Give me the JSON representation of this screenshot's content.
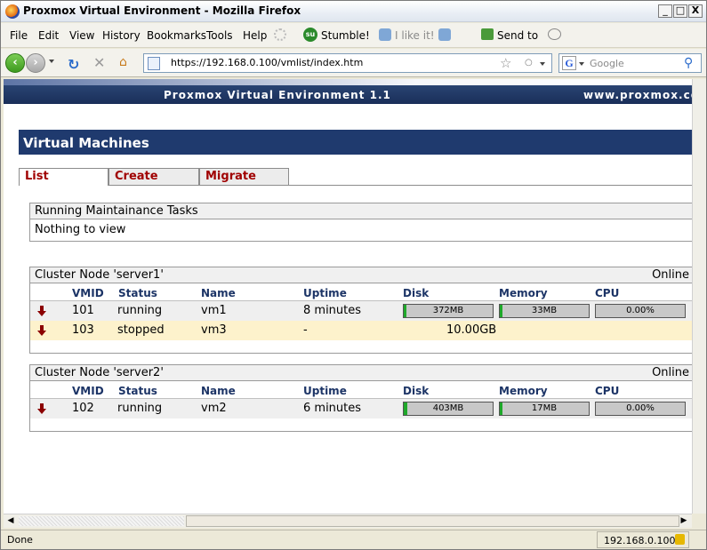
{
  "window": {
    "title": "Proxmox Virtual Environment - Mozilla Firefox",
    "minimize": "_",
    "maximize": "□",
    "close": "X"
  },
  "menu": [
    "File",
    "Edit",
    "View",
    "History",
    "Bookmarks",
    "Tools",
    "Help"
  ],
  "toolbar": {
    "stumble": "Stumble!",
    "like": "I like it!",
    "send_to": "Send to"
  },
  "nav": {
    "url": "https://192.168.0.100/vmlist/index.htm",
    "search_placeholder": "Google"
  },
  "page": {
    "banner_title": "Proxmox Virtual Environment 1.1",
    "banner_url": "www.proxmox.com",
    "section_title": "Virtual Machines",
    "tabs": [
      "List",
      "Create",
      "Migrate"
    ],
    "tasks": {
      "title": "Running Maintainance Tasks",
      "empty": "Nothing to view"
    },
    "columns": [
      "VMID",
      "Status",
      "Name",
      "Uptime",
      "Disk",
      "Memory",
      "CPU"
    ],
    "nodes": [
      {
        "title": "Cluster Node 'server1'",
        "state": "Online",
        "vms": [
          {
            "vmid": "101",
            "status": "running",
            "name": "vm1",
            "uptime": "8 minutes",
            "disk": "372MB",
            "disk_fill": 0.03,
            "memory": "33MB",
            "memory_fill": 0.03,
            "cpu": "0.00%",
            "cpu_fill": 0.0
          },
          {
            "vmid": "103",
            "status": "stopped",
            "name": "vm3",
            "uptime": "-",
            "disk_total": "10.00GB"
          }
        ]
      },
      {
        "title": "Cluster Node 'server2'",
        "state": "Online",
        "vms": [
          {
            "vmid": "102",
            "status": "running",
            "name": "vm2",
            "uptime": "6 minutes",
            "disk": "403MB",
            "disk_fill": 0.04,
            "memory": "17MB",
            "memory_fill": 0.02,
            "cpu": "0.00%",
            "cpu_fill": 0.0
          }
        ]
      }
    ]
  },
  "statusbar": {
    "text": "Done",
    "host": "192.168.0.100"
  },
  "colors": {
    "banner": "#1a2f59",
    "header": "#1f3a6e",
    "tab_text": "#a00000",
    "bar_fill": "#1fa82a",
    "stopped_row": "#fdf2cc"
  }
}
